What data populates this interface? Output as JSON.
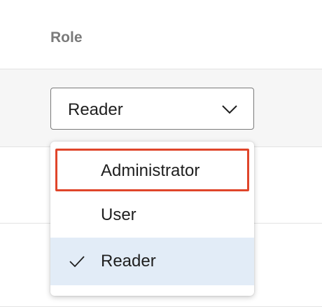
{
  "table": {
    "column_header": "Role"
  },
  "combo": {
    "value": "Reader",
    "icon": "chevron-down-icon"
  },
  "dropdown": {
    "options": [
      {
        "label": "Administrator",
        "selected": false,
        "focused": true
      },
      {
        "label": "User",
        "selected": false,
        "focused": false
      },
      {
        "label": "Reader",
        "selected": true,
        "focused": false
      }
    ],
    "selected_icon": "checkmark-icon"
  },
  "colors": {
    "focus_outline": "#e0452a",
    "selected_option_bg": "#e2ecf7",
    "header_text": "#7a7a7a"
  }
}
